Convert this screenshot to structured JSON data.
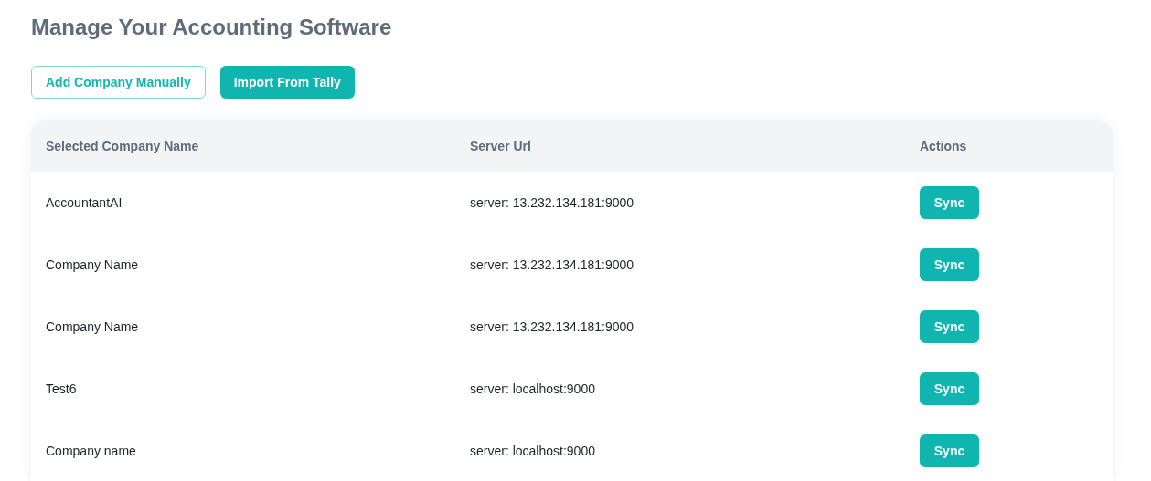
{
  "title": "Manage Your Accounting Software",
  "buttons": [
    {
      "label": "Add Company Manually",
      "kind": "outline"
    },
    {
      "label": "Import From Tally",
      "kind": "solid"
    }
  ],
  "table": {
    "columns": [
      "Selected Company Name",
      "Server Url",
      "Actions"
    ],
    "rows": [
      {
        "company": "AccountantAI",
        "server": "server: 13.232.134.181:9000",
        "action": "Sync"
      },
      {
        "company": "Company Name",
        "server": "server: 13.232.134.181:9000",
        "action": "Sync"
      },
      {
        "company": "Company Name",
        "server": "server: 13.232.134.181:9000",
        "action": "Sync"
      },
      {
        "company": "Test6",
        "server": "server: localhost:9000",
        "action": "Sync"
      },
      {
        "company": "Company name",
        "server": "server: localhost:9000",
        "action": "Sync"
      }
    ]
  }
}
